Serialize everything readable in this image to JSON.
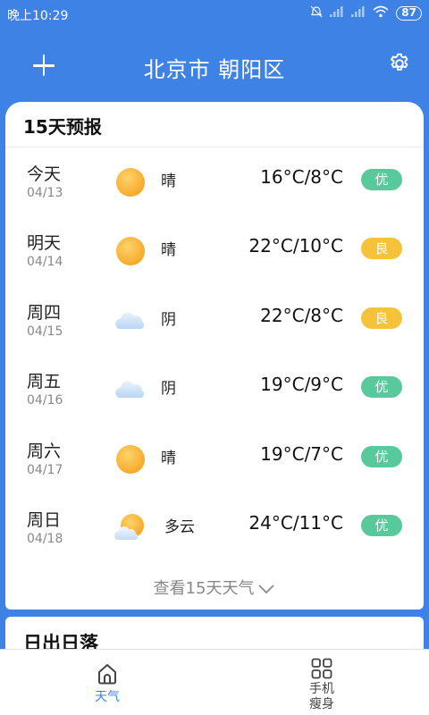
{
  "status_bar": {
    "time": "晚上10:29",
    "battery": "87"
  },
  "header": {
    "city": "北京市  朝阳区"
  },
  "forecast": {
    "title": "15天预报",
    "days": [
      {
        "name": "今天",
        "date": "04/13",
        "icon": "sunny-icon",
        "condition": "晴",
        "temp": "16°C/8°C",
        "aqi": "优",
        "aqi_level": "good"
      },
      {
        "name": "明天",
        "date": "04/14",
        "icon": "sunny-icon",
        "condition": "晴",
        "temp": "22°C/10°C",
        "aqi": "良",
        "aqi_level": "mod"
      },
      {
        "name": "周四",
        "date": "04/15",
        "icon": "overcast-icon",
        "condition": "阴",
        "temp": "22°C/8°C",
        "aqi": "良",
        "aqi_level": "mod"
      },
      {
        "name": "周五",
        "date": "04/16",
        "icon": "overcast-icon",
        "condition": "阴",
        "temp": "19°C/9°C",
        "aqi": "优",
        "aqi_level": "good"
      },
      {
        "name": "周六",
        "date": "04/17",
        "icon": "sunny-icon",
        "condition": "晴",
        "temp": "19°C/7°C",
        "aqi": "优",
        "aqi_level": "good"
      },
      {
        "name": "周日",
        "date": "04/18",
        "icon": "partly-cloudy-icon",
        "condition": "多云",
        "temp": "24°C/11°C",
        "aqi": "优",
        "aqi_level": "good"
      }
    ],
    "more_label": "查看15天天气"
  },
  "sun_card": {
    "title": "日出日落"
  },
  "bottom_nav": {
    "weather_label": "天气",
    "slim_label_line1": "手机",
    "slim_label_line2": "瘦身"
  },
  "colors": {
    "accent": "#3f82e6",
    "aqi_good": "#58c99b",
    "aqi_moderate": "#f5c23a"
  }
}
